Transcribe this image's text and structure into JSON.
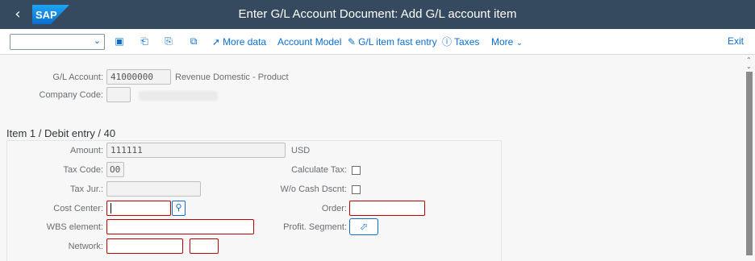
{
  "shell": {
    "back_icon": "chevron-left-icon",
    "logo_text": "SAP",
    "title": "Enter G/L Account Document: Add G/L account item"
  },
  "toolbar": {
    "select_value": "",
    "more_data": "More data",
    "account_model": "Account Model",
    "fast_entry": "G/L item fast entry",
    "taxes": "Taxes",
    "more": "More",
    "exit": "Exit"
  },
  "header_fields": {
    "gl_account_label": "G/L Account:",
    "gl_account_value": "41000000",
    "gl_account_desc": "Revenue Domestic - Product",
    "company_code_label": "Company Code:"
  },
  "item": {
    "section_title": "Item 1 / Debit entry / 40",
    "amount_label": "Amount:",
    "amount_value": "111111",
    "currency": "USD",
    "tax_code_label": "Tax Code:",
    "tax_code_value": "O0",
    "calc_tax_label": "Calculate Tax:",
    "tax_jur_label": "Tax Jur.:",
    "tax_jur_value": "",
    "wo_cash_label": "W/o Cash Dscnt:",
    "cost_center_label": "Cost Center:",
    "cost_center_value": "",
    "order_label": "Order:",
    "order_value": "",
    "wbs_label": "WBS element:",
    "wbs_value": "",
    "profit_seg_label": "Profit. Segment:",
    "network_label": "Network:",
    "network_value": "",
    "network_op_value": ""
  },
  "colors": {
    "shell_bg": "#354a5f",
    "accent": "#0a6ed1",
    "required_border": "#bb0000"
  }
}
